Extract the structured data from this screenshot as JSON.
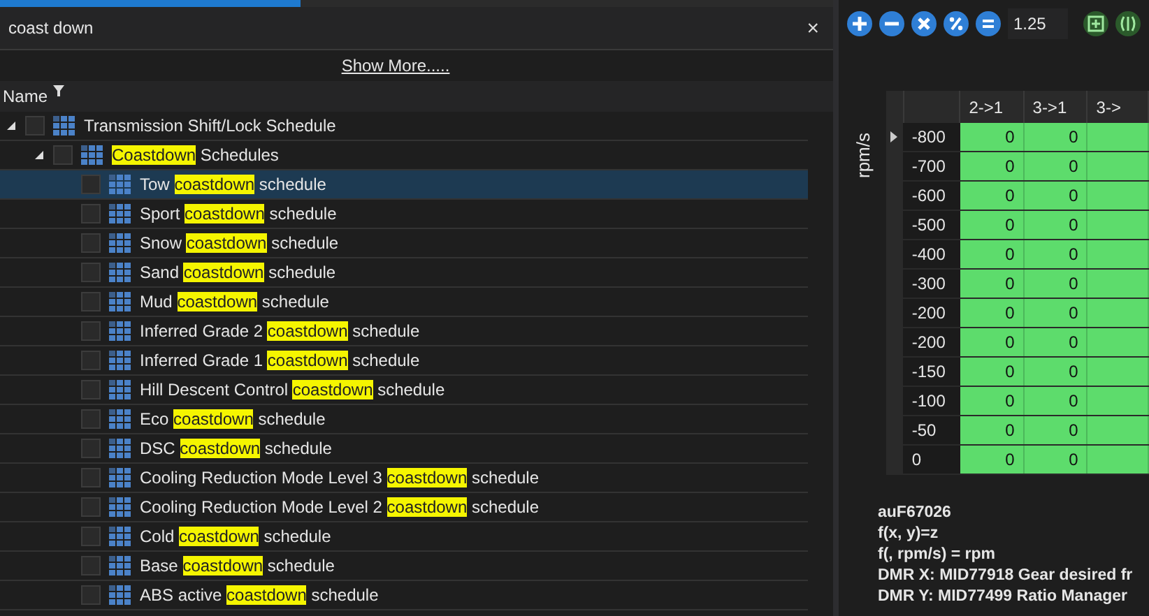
{
  "search": {
    "value": "coast down",
    "clear": "×"
  },
  "show_more": "Show More.....",
  "tree_header": {
    "column": "Name"
  },
  "tree": [
    {
      "parts": [
        {
          "text": "Transmission Shift/Lock Schedule",
          "match": false
        }
      ],
      "expanded": true,
      "checked": false,
      "selected": false,
      "children": [
        {
          "parts": [
            {
              "text": "Coastdown",
              "match": true
            },
            {
              "text": " Schedules",
              "match": false
            }
          ],
          "expanded": true,
          "checked": false,
          "selected": false,
          "children": [
            {
              "parts": [
                {
                  "text": "Tow ",
                  "match": false
                },
                {
                  "text": "coastdown",
                  "match": true
                },
                {
                  "text": " schedule",
                  "match": false
                }
              ],
              "checked": false,
              "selected": true
            },
            {
              "parts": [
                {
                  "text": "Sport ",
                  "match": false
                },
                {
                  "text": "coastdown",
                  "match": true
                },
                {
                  "text": " schedule",
                  "match": false
                }
              ],
              "checked": false,
              "selected": false
            },
            {
              "parts": [
                {
                  "text": "Snow ",
                  "match": false
                },
                {
                  "text": "coastdown",
                  "match": true
                },
                {
                  "text": " schedule",
                  "match": false
                }
              ],
              "checked": false,
              "selected": false
            },
            {
              "parts": [
                {
                  "text": "Sand ",
                  "match": false
                },
                {
                  "text": "coastdown",
                  "match": true
                },
                {
                  "text": " schedule",
                  "match": false
                }
              ],
              "checked": false,
              "selected": false
            },
            {
              "parts": [
                {
                  "text": "Mud ",
                  "match": false
                },
                {
                  "text": "coastdown",
                  "match": true
                },
                {
                  "text": " schedule",
                  "match": false
                }
              ],
              "checked": false,
              "selected": false
            },
            {
              "parts": [
                {
                  "text": "Inferred Grade 2 ",
                  "match": false
                },
                {
                  "text": "coastdown",
                  "match": true
                },
                {
                  "text": " schedule",
                  "match": false
                }
              ],
              "checked": false,
              "selected": false
            },
            {
              "parts": [
                {
                  "text": "Inferred Grade 1 ",
                  "match": false
                },
                {
                  "text": "coastdown",
                  "match": true
                },
                {
                  "text": " schedule",
                  "match": false
                }
              ],
              "checked": false,
              "selected": false
            },
            {
              "parts": [
                {
                  "text": "Hill Descent Control ",
                  "match": false
                },
                {
                  "text": "coastdown",
                  "match": true
                },
                {
                  "text": " schedule",
                  "match": false
                }
              ],
              "checked": false,
              "selected": false
            },
            {
              "parts": [
                {
                  "text": "Eco ",
                  "match": false
                },
                {
                  "text": "coastdown",
                  "match": true
                },
                {
                  "text": " schedule",
                  "match": false
                }
              ],
              "checked": false,
              "selected": false
            },
            {
              "parts": [
                {
                  "text": "DSC ",
                  "match": false
                },
                {
                  "text": "coastdown",
                  "match": true
                },
                {
                  "text": " schedule",
                  "match": false
                }
              ],
              "checked": false,
              "selected": false
            },
            {
              "parts": [
                {
                  "text": "Cooling Reduction Mode Level 3 ",
                  "match": false
                },
                {
                  "text": "coastdown",
                  "match": true
                },
                {
                  "text": " schedule",
                  "match": false
                }
              ],
              "checked": false,
              "selected": false
            },
            {
              "parts": [
                {
                  "text": "Cooling Reduction Mode Level 2 ",
                  "match": false
                },
                {
                  "text": "coastdown",
                  "match": true
                },
                {
                  "text": " schedule",
                  "match": false
                }
              ],
              "checked": false,
              "selected": false
            },
            {
              "parts": [
                {
                  "text": "Cold ",
                  "match": false
                },
                {
                  "text": "coastdown",
                  "match": true
                },
                {
                  "text": " schedule",
                  "match": false
                }
              ],
              "checked": false,
              "selected": false
            },
            {
              "parts": [
                {
                  "text": "Base ",
                  "match": false
                },
                {
                  "text": "coastdown",
                  "match": true
                },
                {
                  "text": " schedule",
                  "match": false
                }
              ],
              "checked": false,
              "selected": false
            },
            {
              "parts": [
                {
                  "text": "ABS active ",
                  "match": false
                },
                {
                  "text": "coastdown",
                  "match": true
                },
                {
                  "text": " schedule",
                  "match": false
                }
              ],
              "checked": false,
              "selected": false
            }
          ]
        }
      ]
    }
  ],
  "toolbar": {
    "operations": [
      {
        "kind": "add"
      },
      {
        "kind": "subtract"
      },
      {
        "kind": "multiply"
      },
      {
        "kind": "percent"
      },
      {
        "kind": "equals"
      }
    ],
    "value": "1.25",
    "tools": [
      {
        "kind": "grid"
      },
      {
        "kind": "split"
      }
    ]
  },
  "table": {
    "y_axis_label": "rpm/s",
    "columns": [
      "2->1",
      "3->1",
      "3->"
    ],
    "rows": [
      {
        "label": "-800",
        "values": [
          "0",
          "0"
        ],
        "current": true
      },
      {
        "label": "-700",
        "values": [
          "0",
          "0"
        ],
        "current": false
      },
      {
        "label": "-600",
        "values": [
          "0",
          "0"
        ],
        "current": false
      },
      {
        "label": "-500",
        "values": [
          "0",
          "0"
        ],
        "current": false
      },
      {
        "label": "-400",
        "values": [
          "0",
          "0"
        ],
        "current": false
      },
      {
        "label": "-300",
        "values": [
          "0",
          "0"
        ],
        "current": false
      },
      {
        "label": "-200",
        "values": [
          "0",
          "0"
        ],
        "current": false
      },
      {
        "label": "-200",
        "values": [
          "0",
          "0"
        ],
        "current": false
      },
      {
        "label": "-150",
        "values": [
          "0",
          "0"
        ],
        "current": false
      },
      {
        "label": "-100",
        "values": [
          "0",
          "0"
        ],
        "current": false
      },
      {
        "label": "-50",
        "values": [
          "0",
          "0"
        ],
        "current": false
      },
      {
        "label": "0",
        "values": [
          "0",
          "0"
        ],
        "current": false
      }
    ]
  },
  "info": [
    "auF67026",
    "f(x, y)=z",
    "f(, rpm/s) = rpm",
    "DMR X: MID77918 Gear desired fr",
    "DMR Y: MID77499 Ratio Manager"
  ]
}
